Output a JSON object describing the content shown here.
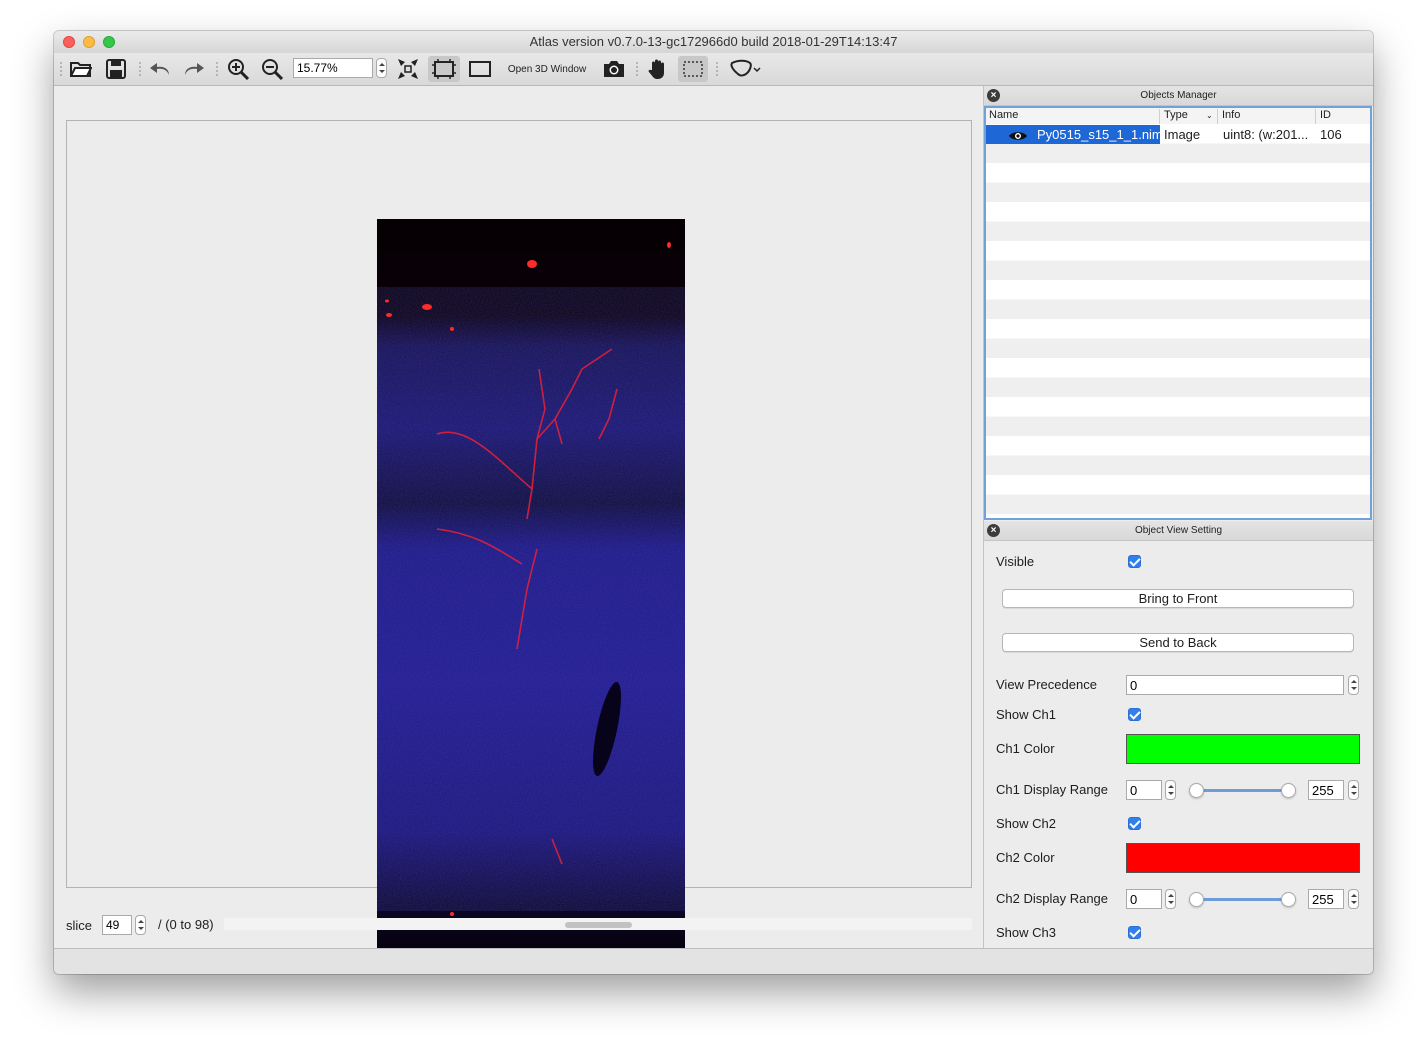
{
  "window": {
    "title": "Atlas version v0.7.0-13-gc172966d0 build 2018-01-29T14:13:47"
  },
  "toolbar": {
    "zoom_value": "15.77%",
    "open_3d_label": "Open 3D Window",
    "icons": [
      "open-folder-icon",
      "save-icon",
      "undo-icon",
      "redo-icon",
      "zoom-in-icon",
      "zoom-out-icon",
      "fit-to-window-icon",
      "fit-view-icon",
      "actual-size-icon",
      "camera-icon",
      "hand-pan-icon",
      "rect-select-icon",
      "lasso-select-icon"
    ]
  },
  "viewer": {
    "slice_label": "slice",
    "slice_value": "49",
    "slice_range": "/ (0 to 98)"
  },
  "objects_manager": {
    "title": "Objects Manager",
    "columns": {
      "name": "Name",
      "type": "Type",
      "info": "Info",
      "id": "ID"
    },
    "rows": [
      {
        "name": "Py0515_s15_1_1.nim",
        "type": "Image",
        "info": "uint8: (w:201...",
        "id": "106"
      }
    ]
  },
  "object_view_setting": {
    "title": "Object View Setting",
    "visible_label": "Visible",
    "bring_to_front": "Bring to Front",
    "send_to_back": "Send to Back",
    "view_precedence_label": "View Precedence",
    "view_precedence_value": "0",
    "show_ch1_label": "Show Ch1",
    "ch1_color_label": "Ch1 Color",
    "ch1_color": "#00ff00",
    "ch1_range_label": "Ch1 Display Range",
    "ch1_min": "0",
    "ch1_max": "255",
    "show_ch2_label": "Show Ch2",
    "ch2_color_label": "Ch2 Color",
    "ch2_color": "#ff0000",
    "ch2_range_label": "Ch2 Display Range",
    "ch2_min": "0",
    "ch2_max": "255",
    "show_ch3_label": "Show Ch3"
  }
}
